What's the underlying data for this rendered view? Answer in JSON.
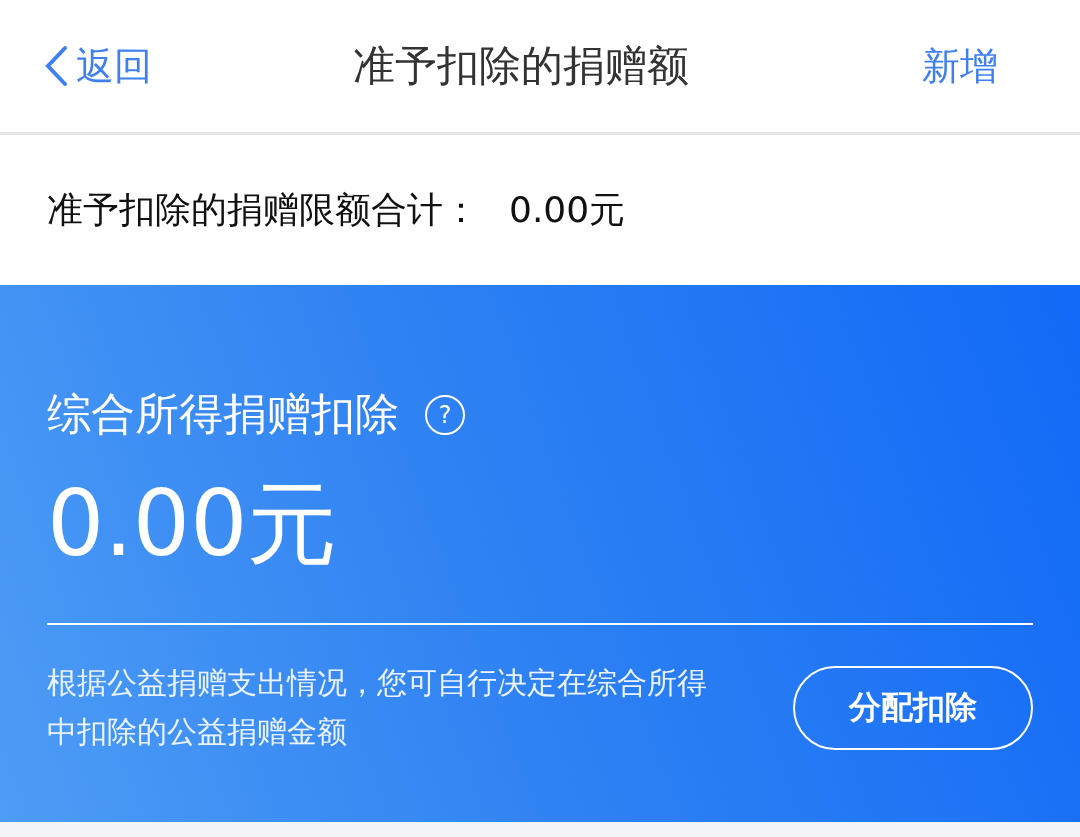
{
  "nav": {
    "back": "返回",
    "title": "准予扣除的捐赠额",
    "action": "新增"
  },
  "summary": {
    "label": "准予扣除的捐赠限额合计：",
    "value": "0.00元"
  },
  "card": {
    "title": "综合所得捐赠扣除",
    "help": "?",
    "amount": "0.00元",
    "description": "根据公益捐赠支出情况，您可自行决定在综合所得中扣除的公益捐赠金额",
    "button": "分配扣除"
  }
}
